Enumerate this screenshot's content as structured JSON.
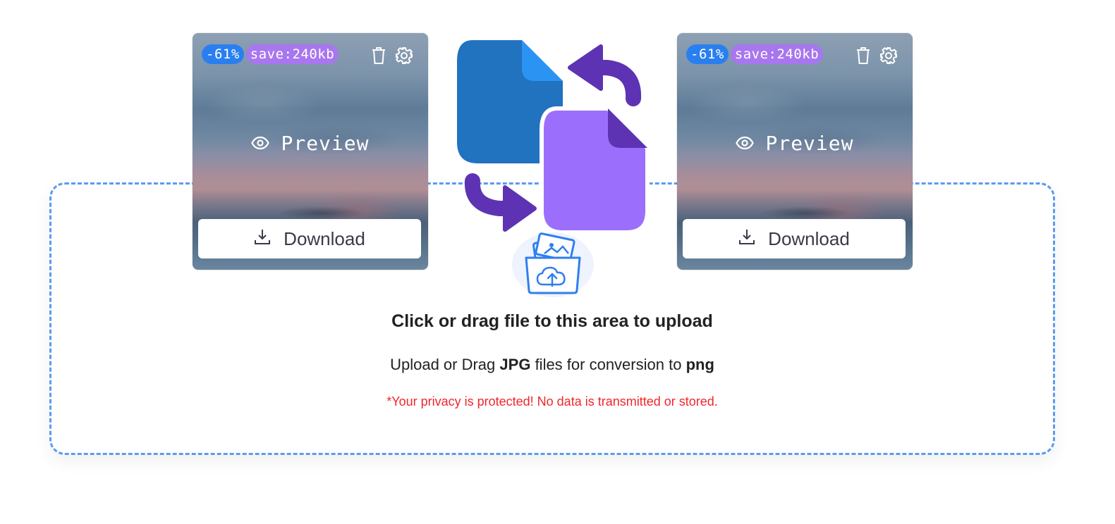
{
  "uploader": {
    "title": "Click or drag file to this area to upload",
    "subtitle_prefix": "Upload or Drag",
    "source_format": "JPG",
    "subtitle_middle": "files for conversion to",
    "target_format": "png",
    "privacy_note": "*Your privacy is protected! No data is transmitted or stored."
  },
  "preview_cards": [
    {
      "reduction_badge": "-61%",
      "savings_badge": "save:240kb",
      "preview_label": "Preview",
      "download_label": "Download",
      "icons": [
        "trash-icon",
        "gear-icon",
        "eye-icon",
        "download-icon"
      ]
    },
    {
      "reduction_badge": "-61%",
      "savings_badge": "save:240kb",
      "preview_label": "Preview",
      "download_label": "Download",
      "icons": [
        "trash-icon",
        "gear-icon",
        "eye-icon",
        "download-icon"
      ]
    }
  ],
  "illustration": {
    "icons": [
      "file-conversion-icon",
      "upload-folder-icon"
    ]
  },
  "colors": {
    "dropzone_border": "#5b9bf0",
    "reduction_badge": "#2a7ff0",
    "savings_badge": "#a876ee",
    "source_file": "#2172bf",
    "target_file": "#9b6ffb",
    "arrows": "#5d33b3",
    "privacy_text": "#f0262b"
  }
}
